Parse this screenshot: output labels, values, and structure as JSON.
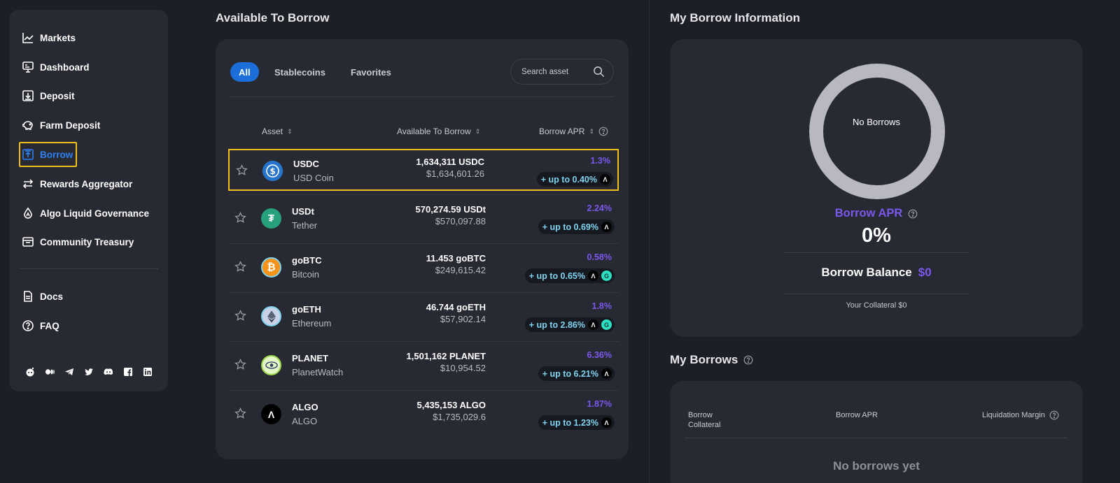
{
  "sidebar": {
    "items": [
      {
        "label": "Markets",
        "icon": "chart-line-icon"
      },
      {
        "label": "Dashboard",
        "icon": "monitor-icon"
      },
      {
        "label": "Deposit",
        "icon": "deposit-icon"
      },
      {
        "label": "Farm Deposit",
        "icon": "piggy-bank-icon"
      },
      {
        "label": "Borrow",
        "icon": "borrow-icon"
      },
      {
        "label": "Rewards Aggregator",
        "icon": "swap-arrows-icon"
      },
      {
        "label": "Algo Liquid Governance",
        "icon": "droplet-icon"
      },
      {
        "label": "Community Treasury",
        "icon": "treasury-box-icon"
      }
    ],
    "secondary": [
      {
        "label": "Docs",
        "icon": "document-icon"
      },
      {
        "label": "FAQ",
        "icon": "question-circle-icon"
      }
    ],
    "socials": [
      "reddit-icon",
      "medium-icon",
      "telegram-icon",
      "twitter-icon",
      "discord-icon",
      "facebook-icon",
      "linkedin-icon"
    ],
    "active_color": "#2f7ff2"
  },
  "available": {
    "title": "Available To Borrow",
    "tabs": [
      "All",
      "Stablecoins",
      "Favorites"
    ],
    "search_placeholder": "Search asset",
    "columns": {
      "asset": "Asset",
      "available": "Available To Borrow",
      "apr": "Borrow APR"
    },
    "rows": [
      {
        "symbol": "USDC",
        "name": "USD Coin",
        "amount": "1,634,311 USDC",
        "usd": "$1,634,601.26",
        "apr": "1.3%",
        "boost": "+ up to 0.40%"
      },
      {
        "symbol": "USDt",
        "name": "Tether",
        "amount": "570,274.59 USDt",
        "usd": "$570,097.88",
        "apr": "2.24%",
        "boost": "+ up to 0.69%"
      },
      {
        "symbol": "goBTC",
        "name": "Bitcoin",
        "amount": "11.453 goBTC",
        "usd": "$249,615.42",
        "apr": "0.58%",
        "boost": "+ up to 0.65%"
      },
      {
        "symbol": "goETH",
        "name": "Ethereum",
        "amount": "46.744 goETH",
        "usd": "$57,902.14",
        "apr": "1.8%",
        "boost": "+ up to 2.86%"
      },
      {
        "symbol": "PLANET",
        "name": "PlanetWatch",
        "amount": "1,501,162 PLANET",
        "usd": "$10,954.52",
        "apr": "6.36%",
        "boost": "+ up to 6.21%"
      },
      {
        "symbol": "ALGO",
        "name": "ALGO",
        "amount": "5,435,153 ALGO",
        "usd": "$1,735,029.6",
        "apr": "1.87%",
        "boost": "+ up to 1.23%"
      }
    ]
  },
  "info": {
    "title": "My Borrow Information",
    "ring_text": "No Borrows",
    "apr_label": "Borrow APR",
    "apr_value": "0%",
    "balance_label": "Borrow Balance",
    "balance_value": "$0",
    "collateral": "Your Collateral $0"
  },
  "my_borrows": {
    "title": "My Borrows",
    "col_borrow": "Borrow",
    "col_collateral": "Collateral",
    "col_apr": "Borrow APR",
    "col_margin": "Liquidation Margin",
    "empty": "No borrows yet"
  },
  "colors": {
    "accent_purple": "#7b58ec",
    "highlight_yellow": "#f2c01b",
    "tab_blue": "#1c6fd8",
    "boost_cyan": "#7fd3ee"
  }
}
